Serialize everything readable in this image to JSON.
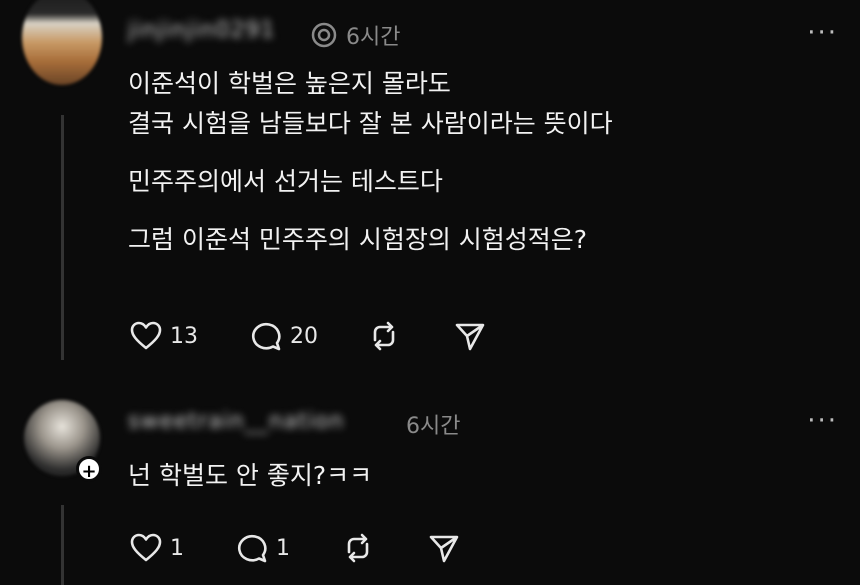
{
  "posts": [
    {
      "username": "jinjinjin0291",
      "time": "6시간",
      "body": [
        "이준석이 학벌은 높은지 몰라도",
        "결국 시험을 남들보다 잘 본 사람이라는 뜻이다",
        "민주주의에서 선거는 테스트다",
        "그럼 이준석 민주주의 시험장의 시험성적은?"
      ],
      "likes": "13",
      "comments": "20"
    },
    {
      "username": "sweetrain__nation",
      "time": "6시간",
      "body": [
        "넌 학벌도 안 좋지?ㅋㅋ"
      ],
      "likes": "1",
      "comments": "1"
    }
  ],
  "more_label": "···",
  "plus_label": "+"
}
